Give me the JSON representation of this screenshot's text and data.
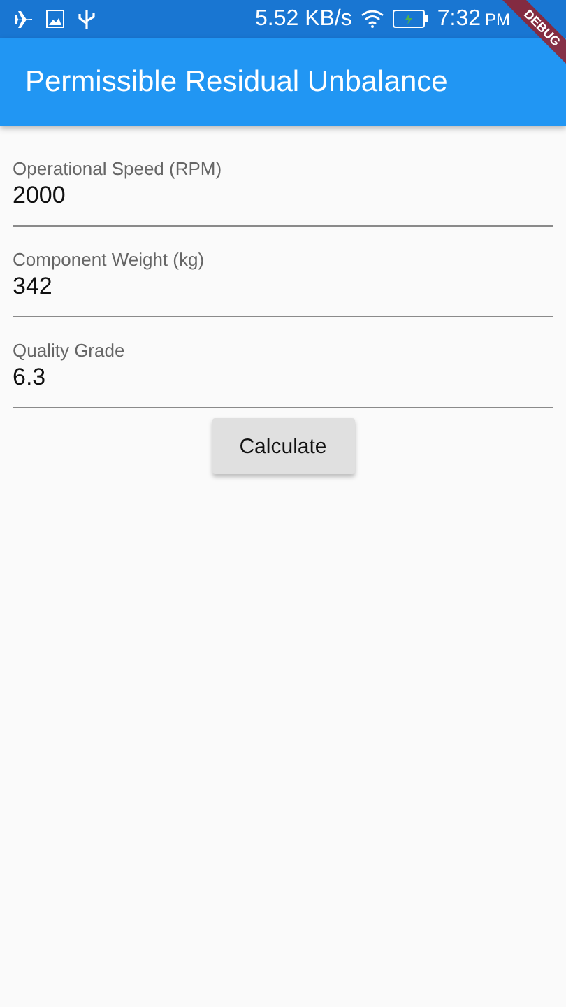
{
  "status_bar": {
    "net_speed": "5.52 KB/s",
    "time": "7:32",
    "ampm": "PM"
  },
  "app_bar": {
    "title": "Permissible Residual Unbalance"
  },
  "debug_banner": "DEBUG",
  "fields": [
    {
      "label": "Operational Speed (RPM)",
      "value": "2000"
    },
    {
      "label": "Component Weight (kg)",
      "value": "342"
    },
    {
      "label": "Quality Grade",
      "value": "6.3"
    }
  ],
  "button": "Calculate"
}
